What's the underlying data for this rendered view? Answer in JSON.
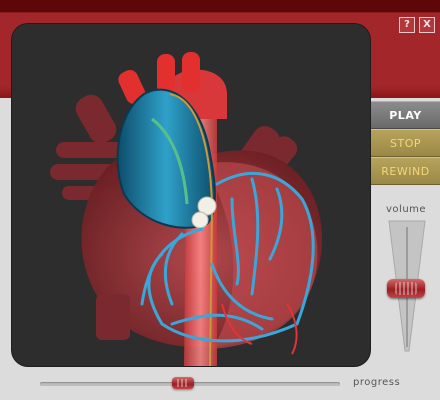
{
  "window": {
    "help_glyph": "?",
    "close_glyph": "X"
  },
  "controls": {
    "play_label": "PLAY",
    "stop_label": "STOP",
    "rewind_label": "REWIND"
  },
  "volume": {
    "label": "volume",
    "level": 0.5
  },
  "progress": {
    "label": "progress",
    "value": 0.47
  },
  "colors": {
    "accent": "#a3262a",
    "button_gold": "#f3d67a",
    "stage_bg": "#2d2d2d"
  }
}
